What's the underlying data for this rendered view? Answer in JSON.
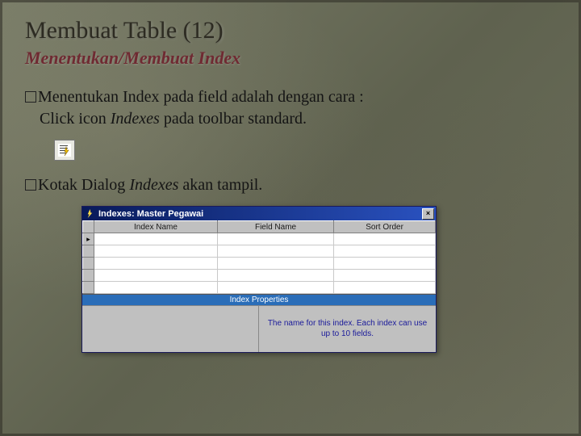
{
  "slide": {
    "title": "Membuat Table (12)",
    "subtitle": "Menentukan/Membuat Index",
    "para1_a": "Menentukan Index pada field adalah dengan cara :",
    "para1_b": "Click icon ",
    "para1_b_em": "Indexes",
    "para1_b_tail": " pada toolbar standard.",
    "para2_a": "Kotak Dialog ",
    "para2_em": "Indexes",
    "para2_tail": " akan tampil."
  },
  "dialog": {
    "title": "Indexes: Master Pegawai",
    "close": "×",
    "columns": [
      "Index Name",
      "Field Name",
      "Sort Order"
    ],
    "props_header": "Index Properties",
    "help_text": "The name for this index. Each index can use up to 10 fields."
  }
}
